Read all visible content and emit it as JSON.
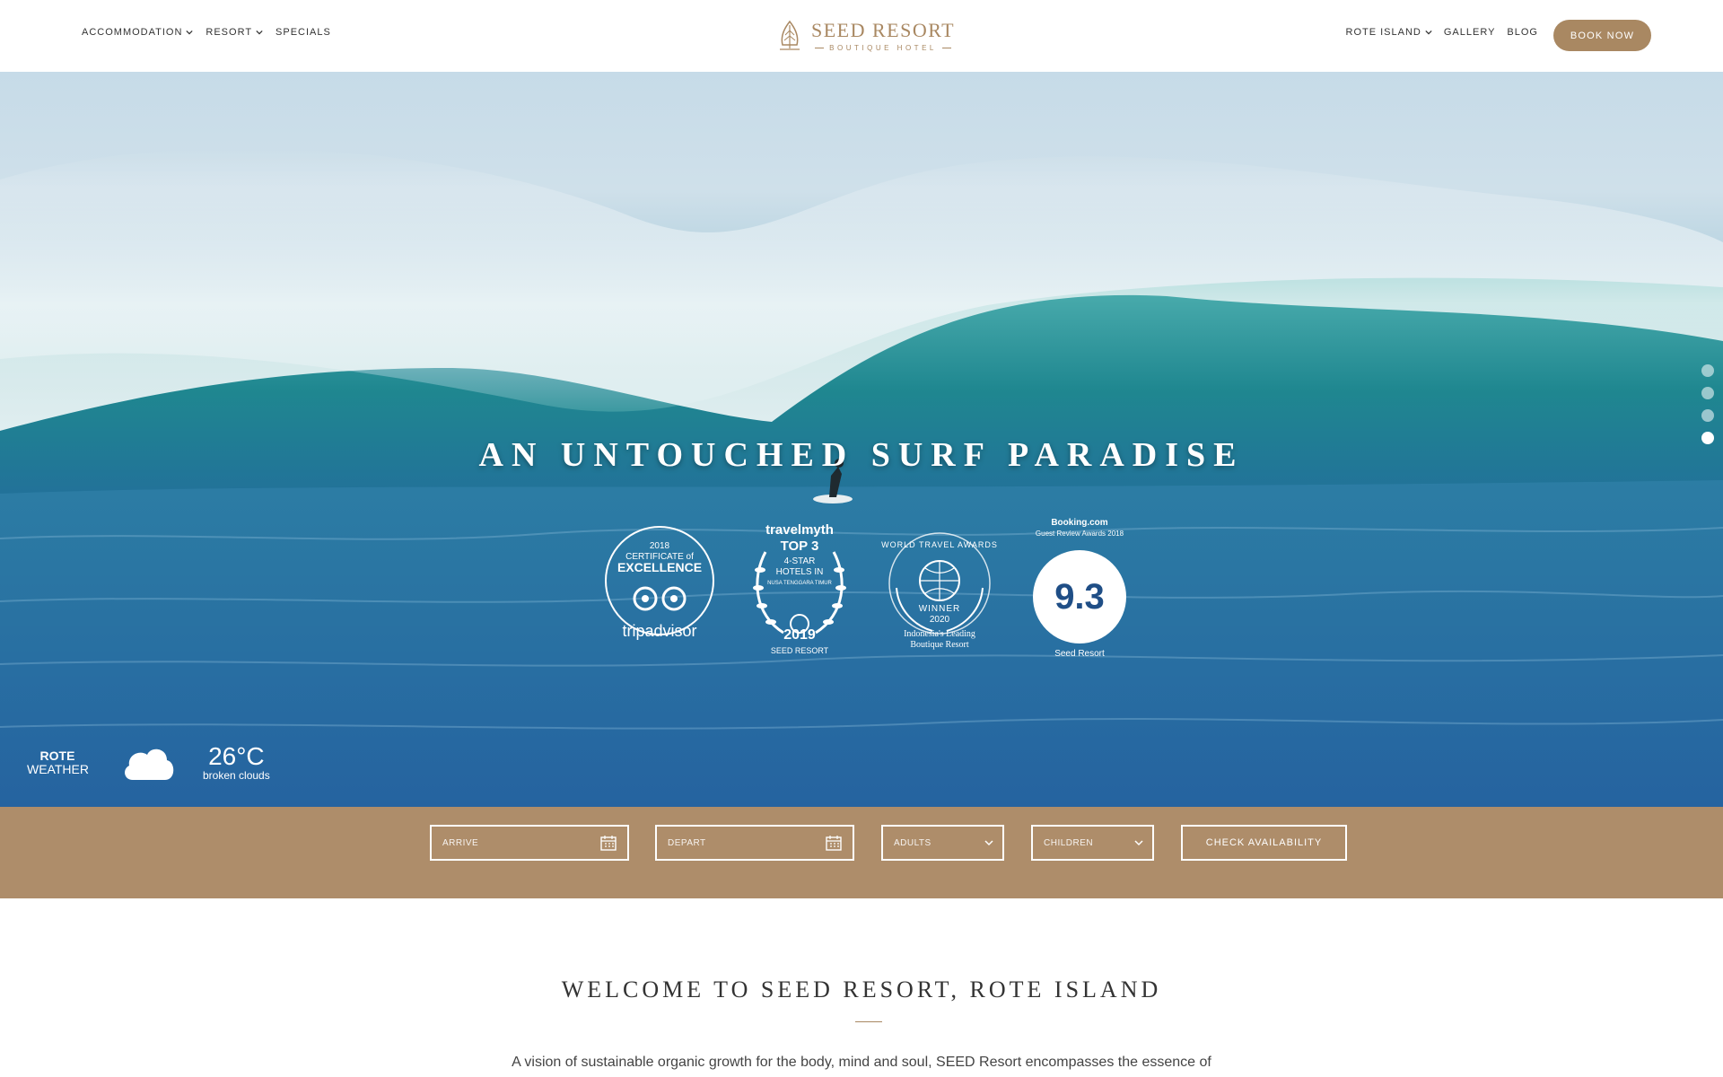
{
  "header": {
    "nav_left": [
      "ACCOMMODATION",
      "RESORT",
      "SPECIALS"
    ],
    "nav_right": [
      "ROTE ISLAND",
      "GALLERY",
      "BLOG"
    ],
    "book_button": "BOOK NOW",
    "logo": {
      "title": "SEED RESORT",
      "subtitle": "BOUTIQUE HOTEL"
    },
    "colors": {
      "brand": "#a98862"
    }
  },
  "hero": {
    "title": "AN UNTOUCHED SURF PARADISE",
    "slide_indicator": {
      "count": 4,
      "active_index": 4
    },
    "awards": [
      {
        "name": "tripadvisor-award",
        "lines": [
          "2018",
          "CERTIFICATE of",
          "EXCELLENCE",
          "tripadvisor"
        ]
      },
      {
        "name": "travelmyth-award",
        "lines": [
          "travelmyth",
          "TOP 3",
          "4-STAR",
          "HOTELS IN",
          "NUSA TENGGARA TIMUR",
          "2019",
          "SEED RESORT"
        ]
      },
      {
        "name": "world-travel-awards",
        "lines": [
          "WORLD TRAVEL AWARDS",
          "WINNER",
          "2020",
          "Indonesia's Leading",
          "Boutique Resort"
        ]
      },
      {
        "name": "booking-award",
        "lines": [
          "Booking.com",
          "Guest Review Awards 2018",
          "9.3",
          "Seed Resort"
        ]
      }
    ],
    "weather": {
      "place_line1": "ROTE",
      "place_line2": "WEATHER",
      "icon": "cloud-icon",
      "temperature": "26°C",
      "description": "broken clouds"
    }
  },
  "booking": {
    "arrive": "ARRIVE",
    "depart": "DEPART",
    "adults": "ADULTS",
    "children": "CHILDREN",
    "check_button": "CHECK AVAILABILITY",
    "background": "#ae8d6a"
  },
  "welcome": {
    "title": "WELCOME TO SEED RESORT, ROTE ISLAND",
    "text": "A vision of sustainable organic growth for the body, mind and soul, SEED Resort encompasses the essence of"
  }
}
